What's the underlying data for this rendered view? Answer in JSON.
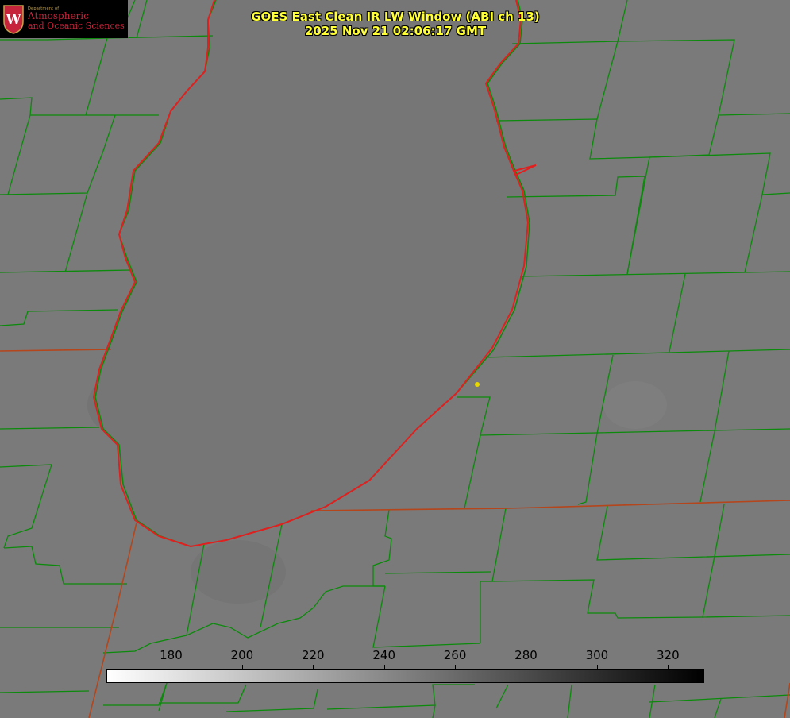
{
  "logo": {
    "department": "Department of",
    "line1": "Atmospheric",
    "line2": "and Oceanic Sciences"
  },
  "title": {
    "line1": "GOES East Clean IR LW Window (ABI ch 13)",
    "line2": "2025 Nov 21 02:06:17 GMT"
  },
  "colorbar": {
    "ticks": [
      "180",
      "200",
      "220",
      "240",
      "260",
      "280",
      "300",
      "320"
    ],
    "range": [
      162,
      330
    ],
    "scheme": "white-to-black"
  },
  "colors": {
    "title": "#ffff33",
    "borders": "#0b8a0b",
    "shoreline": "#e0201f",
    "marker": "#e8d800",
    "background": "#7a7a7a"
  }
}
